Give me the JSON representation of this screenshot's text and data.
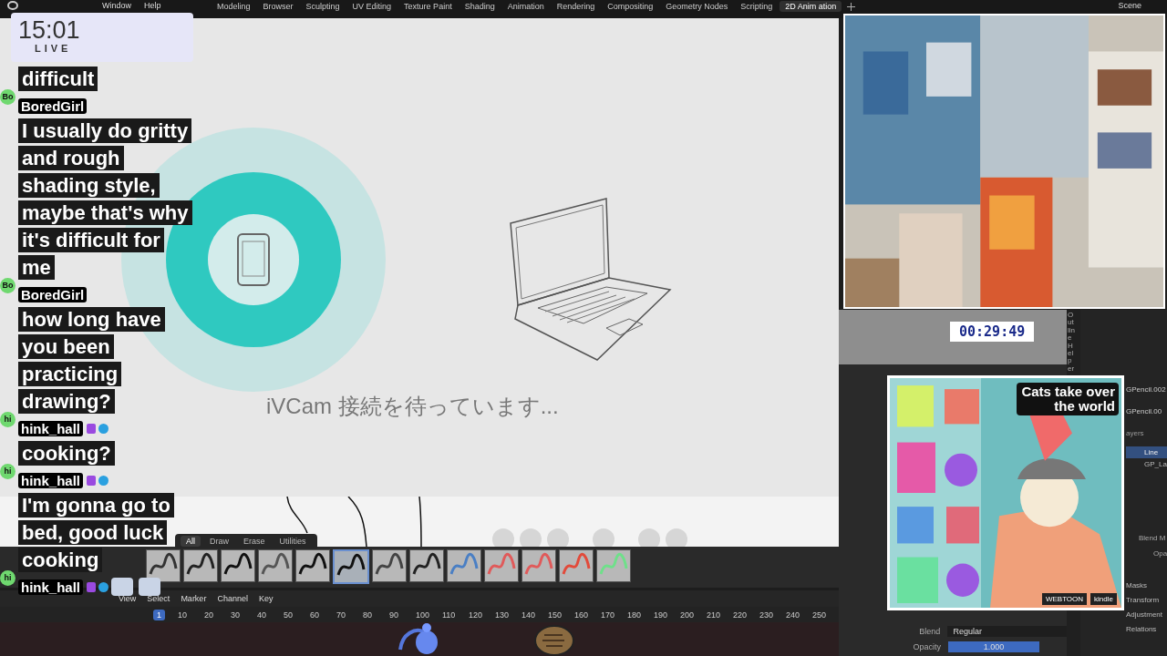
{
  "menu": [
    "Window",
    "Help"
  ],
  "workspaces": [
    {
      "label": "Modeling",
      "selected": false
    },
    {
      "label": "Browser",
      "selected": false
    },
    {
      "label": "Sculpting",
      "selected": false
    },
    {
      "label": "UV Editing",
      "selected": false
    },
    {
      "label": "Texture Paint",
      "selected": false
    },
    {
      "label": "Shading",
      "selected": false
    },
    {
      "label": "Animation",
      "selected": false
    },
    {
      "label": "Rendering",
      "selected": false
    },
    {
      "label": "Compositing",
      "selected": false
    },
    {
      "label": "Geometry Nodes",
      "selected": false
    },
    {
      "label": "Scripting",
      "selected": false
    },
    {
      "label": "2D Anim ation",
      "selected": true
    }
  ],
  "scene": "Scene",
  "viewport": {
    "message": "iVCam 接続を待っています..."
  },
  "brush_tabs": [
    {
      "label": "All",
      "selected": true
    },
    {
      "label": "Draw",
      "selected": false
    },
    {
      "label": "Erase",
      "selected": false
    },
    {
      "label": "Utilities",
      "selected": false
    }
  ],
  "brushes": [
    {
      "selected": false
    },
    {
      "selected": false
    },
    {
      "selected": false
    },
    {
      "selected": false
    },
    {
      "selected": false
    },
    {
      "selected": true
    },
    {
      "selected": false
    },
    {
      "selected": false
    },
    {
      "selected": false
    },
    {
      "selected": false
    },
    {
      "selected": false
    },
    {
      "selected": false
    },
    {
      "selected": false
    }
  ],
  "timeline": {
    "menu": [
      "View",
      "Select",
      "Marker",
      "Channel",
      "Key"
    ],
    "current_frame": "1",
    "ticks": [
      "10",
      "20",
      "30",
      "40",
      "50",
      "60",
      "70",
      "80",
      "90",
      "100",
      "110",
      "120",
      "130",
      "140",
      "150",
      "160",
      "170",
      "180",
      "190",
      "200",
      "210",
      "220",
      "230",
      "240",
      "250"
    ]
  },
  "timer": "00:29:49",
  "properties": {
    "objects": [
      "GPencil.002",
      "GPencil.00"
    ],
    "layers_label": "ayers",
    "layers": [
      {
        "label": "Line",
        "selected": true
      },
      {
        "label": "GP_La",
        "selected": false
      }
    ],
    "fields": [
      "Blend M",
      "Opa"
    ],
    "sections": [
      "Masks",
      "Transform",
      "Adjustment",
      "Relations"
    ],
    "blend_label": "Blend",
    "blend_value": "Regular",
    "opacity": {
      "label": "Opacity",
      "value": "1.000",
      "level": 1
    }
  },
  "side_tab": "Outline Helper",
  "poster": {
    "headline": "Cats take over the world",
    "badges": [
      "WEBTOON",
      "kindle"
    ]
  },
  "clock": {
    "time": "15:01",
    "status": "LIVE"
  },
  "chat": [
    {
      "text": "difficult"
    },
    {
      "avatar": "Bo",
      "user": "BoredGirl",
      "text": "I usually do gritty and rough shading style, maybe that's why it's difficult for me"
    },
    {
      "avatar": "Bo",
      "user": "BoredGirl",
      "text": "how long have you been practicing drawing?"
    },
    {
      "avatar": "hi",
      "user": "hink_hall",
      "badges": true
    },
    {
      "text": "cooking?"
    },
    {
      "avatar": "hi",
      "user": "hink_hall",
      "text": "I'm gonna go to bed, good luck cooking",
      "badges": true
    },
    {
      "avatar": "hi",
      "user": "hink_hall",
      "badges": true,
      "emotes": true
    }
  ]
}
